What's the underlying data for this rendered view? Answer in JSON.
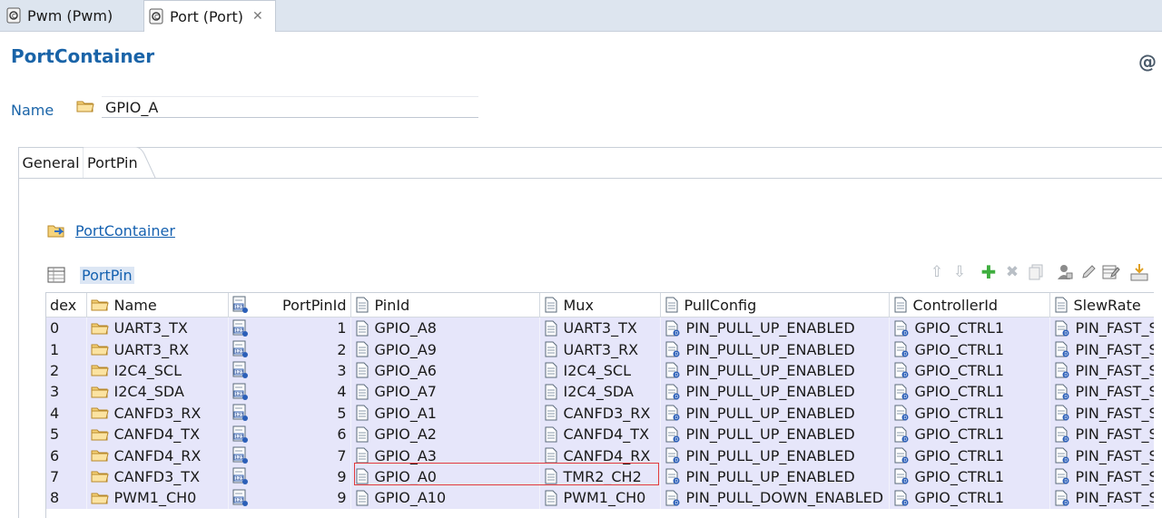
{
  "editor_tabs": [
    {
      "label": "Pwm (Pwm)",
      "active": false
    },
    {
      "label": "Port (Port)",
      "active": true,
      "closable": true
    }
  ],
  "header": {
    "title": "PortContainer",
    "at_symbol": "@"
  },
  "name_field": {
    "label": "Name",
    "value": "GPIO_A"
  },
  "form_tabs": [
    {
      "label": "General",
      "active": false
    },
    {
      "label": "PortPin",
      "active": true
    }
  ],
  "link": {
    "label": "PortContainer"
  },
  "table": {
    "title": "PortPin",
    "columns": [
      "dex",
      "Name",
      "PortPinId",
      "PinId",
      "Mux",
      "PullConfig",
      "ControllerId",
      "SlewRate"
    ],
    "rows": [
      {
        "index": "0",
        "name": "UART3_TX",
        "portpinid": "1",
        "pinid": "GPIO_A8",
        "mux": "UART3_TX",
        "pull": "PIN_PULL_UP_ENABLED",
        "ctrl": "GPIO_CTRL1",
        "slew": "PIN_FAST_S"
      },
      {
        "index": "1",
        "name": "UART3_RX",
        "portpinid": "2",
        "pinid": "GPIO_A9",
        "mux": "UART3_RX",
        "pull": "PIN_PULL_UP_ENABLED",
        "ctrl": "GPIO_CTRL1",
        "slew": "PIN_FAST_S"
      },
      {
        "index": "2",
        "name": "I2C4_SCL",
        "portpinid": "3",
        "pinid": "GPIO_A6",
        "mux": "I2C4_SCL",
        "pull": "PIN_PULL_UP_ENABLED",
        "ctrl": "GPIO_CTRL1",
        "slew": "PIN_FAST_S"
      },
      {
        "index": "3",
        "name": "I2C4_SDA",
        "portpinid": "4",
        "pinid": "GPIO_A7",
        "mux": "I2C4_SDA",
        "pull": "PIN_PULL_UP_ENABLED",
        "ctrl": "GPIO_CTRL1",
        "slew": "PIN_FAST_S"
      },
      {
        "index": "4",
        "name": "CANFD3_RX",
        "portpinid": "5",
        "pinid": "GPIO_A1",
        "mux": "CANFD3_RX",
        "pull": "PIN_PULL_UP_ENABLED",
        "ctrl": "GPIO_CTRL1",
        "slew": "PIN_FAST_S"
      },
      {
        "index": "5",
        "name": "CANFD4_TX",
        "portpinid": "6",
        "pinid": "GPIO_A2",
        "mux": "CANFD4_TX",
        "pull": "PIN_PULL_UP_ENABLED",
        "ctrl": "GPIO_CTRL1",
        "slew": "PIN_FAST_S"
      },
      {
        "index": "6",
        "name": "CANFD4_RX",
        "portpinid": "7",
        "pinid": "GPIO_A3",
        "mux": "CANFD4_RX",
        "pull": "PIN_PULL_UP_ENABLED",
        "ctrl": "GPIO_CTRL1",
        "slew": "PIN_FAST_S"
      },
      {
        "index": "7",
        "name": "CANFD3_TX",
        "portpinid": "9",
        "pinid": "GPIO_A0",
        "mux": "TMR2_CH2",
        "pull": "PIN_PULL_UP_ENABLED",
        "ctrl": "GPIO_CTRL1",
        "slew": "PIN_FAST_S"
      },
      {
        "index": "8",
        "name": "PWM1_CH0",
        "portpinid": "9",
        "pinid": "GPIO_A10",
        "mux": "PWM1_CH0",
        "pull": "PIN_PULL_DOWN_ENABLED",
        "ctrl": "GPIO_CTRL1",
        "slew": "PIN_FAST_S"
      }
    ]
  },
  "colors": {
    "title_blue": "#1a64a8",
    "link_blue": "#1561b0",
    "row_bg": "#e6e6fa",
    "highlight_red": "#e23b3b"
  },
  "icons": {
    "editor_tab": "config-module-icon",
    "name": "folder-icon",
    "link": "container-link-icon",
    "table": "table-icon",
    "toolbar": [
      "move-up-icon",
      "move-down-icon",
      "add-icon",
      "delete-icon",
      "copy-icon",
      "user-config-icon",
      "edit-icon",
      "table-edit-icon",
      "import-icon"
    ]
  }
}
